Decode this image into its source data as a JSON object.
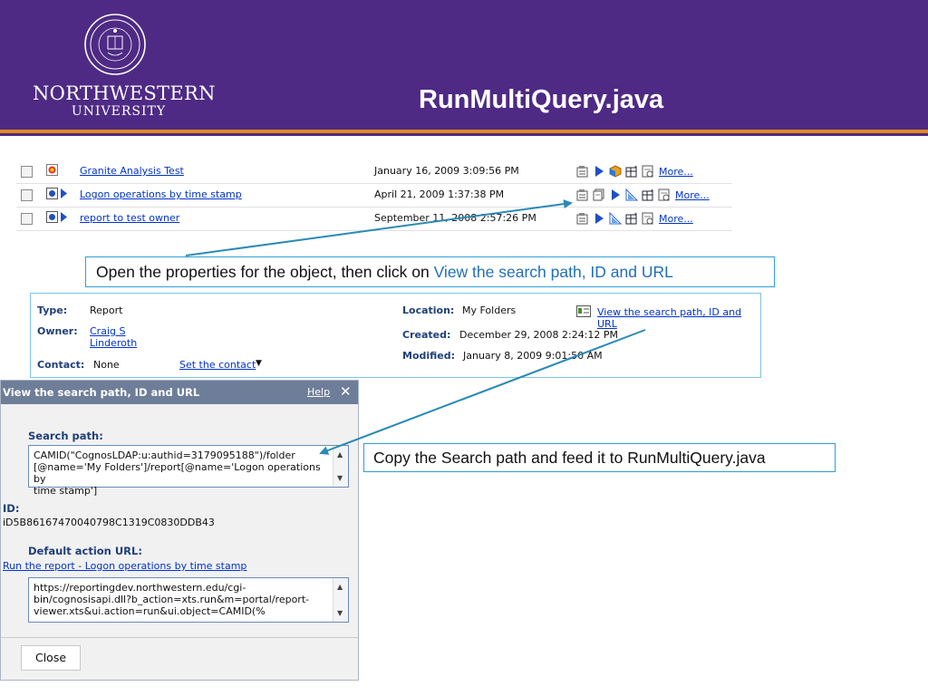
{
  "slide": {
    "title": "RunMultiQuery.java",
    "logo_name": "NORTHWESTERN",
    "logo_university": "UNIVERSITY",
    "colors": {
      "purple": "#4e2a84",
      "orange": "#e3891e",
      "callout_border": "#2e9fd8",
      "link": "#0033cc",
      "arrow": "#2a8ab5"
    }
  },
  "list": {
    "rows": [
      {
        "name": "Granite Analysis Test",
        "date": "January 16, 2009 3:09:56 PM",
        "more": "More..."
      },
      {
        "name": "Logon operations by time stamp",
        "date": "April 21, 2009 1:37:38 PM",
        "more": "More..."
      },
      {
        "name": "report to test owner",
        "date": "September 11, 2008 2:57:26 PM",
        "more": "More..."
      }
    ]
  },
  "callouts": {
    "top_prefix": "Open the properties for the object, then click on ",
    "top_highlight": "View the search path, ID and URL",
    "right": "Copy the Search path and feed it to RunMultiQuery.java"
  },
  "properties": {
    "type_label": "Type:",
    "type_value": "Report",
    "owner_label": "Owner:",
    "owner_line1": "Craig S",
    "owner_line2": "Linderoth",
    "contact_label": "Contact:",
    "contact_value": "None",
    "set_contact": "Set the contact",
    "location_label": "Location:",
    "location_value": "My Folders",
    "view_link": "View the search path, ID and URL",
    "created_label": "Created:",
    "created_value": "December 29, 2008 2:24:12 PM",
    "modified_label": "Modified:",
    "modified_value": "January 8, 2009 9:01:50 AM"
  },
  "dialog": {
    "title": "View the search path, ID and URL",
    "help": "Help",
    "close_x": "✕",
    "search_path_label": "Search path:",
    "search_path_line1": "CAMID(\"CognosLDAP:u:authid=3179095188\")/folder",
    "search_path_line2": "[@name='My Folders']/report[@name='Logon operations by",
    "search_path_line3": "time stamp']",
    "id_label": "ID:",
    "id_value": "iD5B86167470040798C1319C0830DDB43",
    "default_url_label": "Default action URL:",
    "run_link": "Run the report - Logon operations by time stamp",
    "url_line1": "https://reportingdev.northwestern.edu/cgi-",
    "url_line2": "bin/cognosisapi.dll?b_action=xts.run&m=portal/report-",
    "url_line3": "viewer.xts&ui.action=run&ui.object=CAMID(%",
    "close_button": "Close"
  }
}
